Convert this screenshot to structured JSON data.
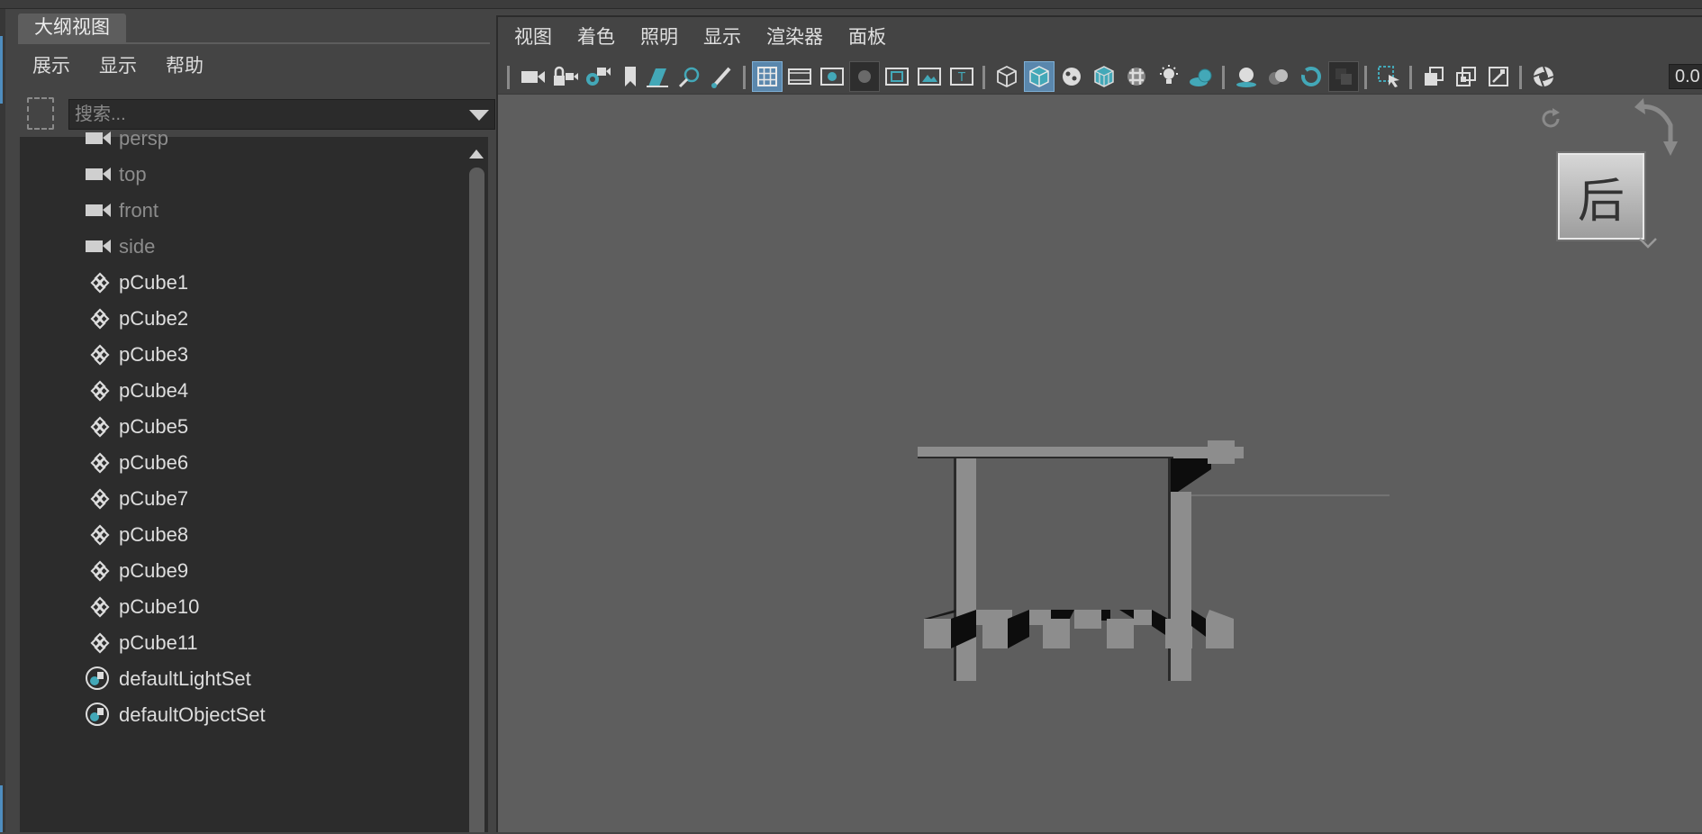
{
  "outliner": {
    "tab_title": "大纲视图",
    "menu": [
      "展示",
      "显示",
      "帮助"
    ],
    "search_placeholder": "搜索...",
    "items": [
      {
        "label": "persp",
        "kind": "camera"
      },
      {
        "label": "top",
        "kind": "camera"
      },
      {
        "label": "front",
        "kind": "camera"
      },
      {
        "label": "side",
        "kind": "camera"
      },
      {
        "label": "pCube1",
        "kind": "mesh"
      },
      {
        "label": "pCube2",
        "kind": "mesh"
      },
      {
        "label": "pCube3",
        "kind": "mesh"
      },
      {
        "label": "pCube4",
        "kind": "mesh"
      },
      {
        "label": "pCube5",
        "kind": "mesh"
      },
      {
        "label": "pCube6",
        "kind": "mesh"
      },
      {
        "label": "pCube7",
        "kind": "mesh"
      },
      {
        "label": "pCube8",
        "kind": "mesh"
      },
      {
        "label": "pCube9",
        "kind": "mesh"
      },
      {
        "label": "pCube10",
        "kind": "mesh"
      },
      {
        "label": "pCube11",
        "kind": "mesh"
      },
      {
        "label": "defaultLightSet",
        "kind": "set"
      },
      {
        "label": "defaultObjectSet",
        "kind": "set"
      }
    ]
  },
  "viewport": {
    "menu": [
      "视图",
      "着色",
      "照明",
      "显示",
      "渲染器",
      "面板"
    ],
    "field_value": "0.0",
    "viewcube_label": "后",
    "colors": {
      "accent": "#5a87ad",
      "viewport_bg": "#5e5e5e",
      "mesh": "#8d8d8d",
      "icon_teal": "#43a8b8"
    }
  }
}
